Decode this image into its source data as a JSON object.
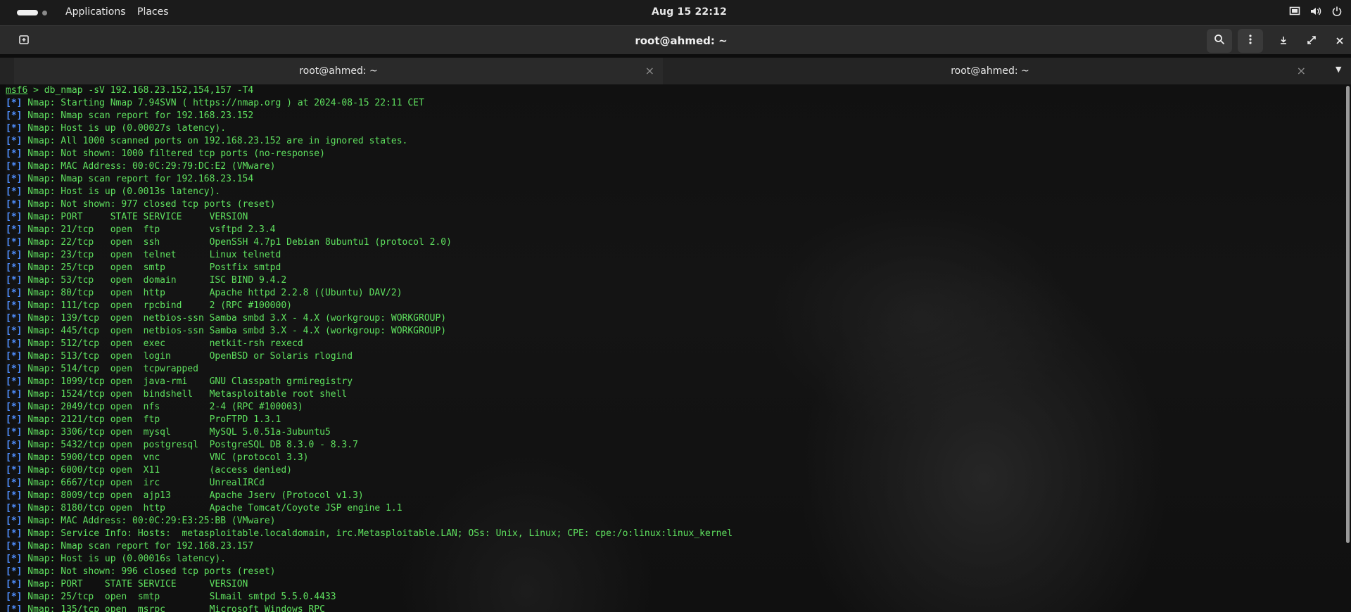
{
  "topbar": {
    "applications": "Applications",
    "places": "Places",
    "clock": "Aug 15  22:12",
    "icons": [
      "screen-icon",
      "volume-icon",
      "power-icon"
    ]
  },
  "window": {
    "title": "root@ahmed: ~",
    "icons": [
      "new-tab-icon",
      "search-icon",
      "menu-icon",
      "minimize-icon",
      "maximize-icon",
      "close-icon"
    ]
  },
  "tabs": [
    {
      "label": "root@ahmed: ~",
      "close": "×"
    },
    {
      "label": "root@ahmed: ~",
      "close": "×"
    }
  ],
  "terminal": {
    "prompt": "msf6",
    "command": " > db_nmap -sV 192.168.23.152,154,157 -T4",
    "tag": "[*]",
    "lines": [
      " Nmap: Starting Nmap 7.94SVN ( https://nmap.org ) at 2024-08-15 22:11 CET",
      " Nmap: Nmap scan report for 192.168.23.152",
      " Nmap: Host is up (0.00027s latency).",
      " Nmap: All 1000 scanned ports on 192.168.23.152 are in ignored states.",
      " Nmap: Not shown: 1000 filtered tcp ports (no-response)",
      " Nmap: MAC Address: 00:0C:29:79:DC:E2 (VMware)",
      " Nmap: Nmap scan report for 192.168.23.154",
      " Nmap: Host is up (0.0013s latency).",
      " Nmap: Not shown: 977 closed tcp ports (reset)",
      " Nmap: PORT     STATE SERVICE     VERSION",
      " Nmap: 21/tcp   open  ftp         vsftpd 2.3.4",
      " Nmap: 22/tcp   open  ssh         OpenSSH 4.7p1 Debian 8ubuntu1 (protocol 2.0)",
      " Nmap: 23/tcp   open  telnet      Linux telnetd",
      " Nmap: 25/tcp   open  smtp        Postfix smtpd",
      " Nmap: 53/tcp   open  domain      ISC BIND 9.4.2",
      " Nmap: 80/tcp   open  http        Apache httpd 2.2.8 ((Ubuntu) DAV/2)",
      " Nmap: 111/tcp  open  rpcbind     2 (RPC #100000)",
      " Nmap: 139/tcp  open  netbios-ssn Samba smbd 3.X - 4.X (workgroup: WORKGROUP)",
      " Nmap: 445/tcp  open  netbios-ssn Samba smbd 3.X - 4.X (workgroup: WORKGROUP)",
      " Nmap: 512/tcp  open  exec        netkit-rsh rexecd",
      " Nmap: 513/tcp  open  login       OpenBSD or Solaris rlogind",
      " Nmap: 514/tcp  open  tcpwrapped",
      " Nmap: 1099/tcp open  java-rmi    GNU Classpath grmiregistry",
      " Nmap: 1524/tcp open  bindshell   Metasploitable root shell",
      " Nmap: 2049/tcp open  nfs         2-4 (RPC #100003)",
      " Nmap: 2121/tcp open  ftp         ProFTPD 1.3.1",
      " Nmap: 3306/tcp open  mysql       MySQL 5.0.51a-3ubuntu5",
      " Nmap: 5432/tcp open  postgresql  PostgreSQL DB 8.3.0 - 8.3.7",
      " Nmap: 5900/tcp open  vnc         VNC (protocol 3.3)",
      " Nmap: 6000/tcp open  X11         (access denied)",
      " Nmap: 6667/tcp open  irc         UnrealIRCd",
      " Nmap: 8009/tcp open  ajp13       Apache Jserv (Protocol v1.3)",
      " Nmap: 8180/tcp open  http        Apache Tomcat/Coyote JSP engine 1.1",
      " Nmap: MAC Address: 00:0C:29:E3:25:BB (VMware)",
      " Nmap: Service Info: Hosts:  metasploitable.localdomain, irc.Metasploitable.LAN; OSs: Unix, Linux; CPE: cpe:/o:linux:linux_kernel",
      " Nmap: Nmap scan report for 192.168.23.157",
      " Nmap: Host is up (0.00016s latency).",
      " Nmap: Not shown: 996 closed tcp ports (reset)",
      " Nmap: PORT    STATE SERVICE      VERSION",
      " Nmap: 25/tcp  open  smtp         SLmail smtpd 5.5.0.4433",
      " Nmap: 135/tcp open  msrpc        Microsoft Windows RPC"
    ]
  },
  "colors": {
    "text_green": "#5fe15f",
    "tag_blue": "#4f8fff",
    "tab_accent": "#3584e4"
  }
}
